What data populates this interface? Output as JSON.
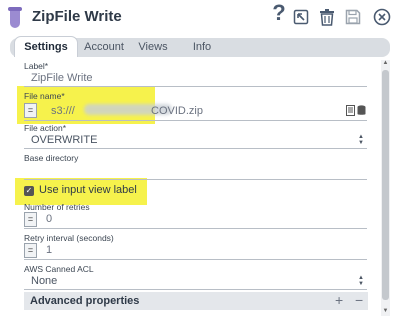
{
  "header": {
    "title": "ZipFile Write",
    "icons": [
      "help-icon",
      "export-icon",
      "delete-icon",
      "save-icon",
      "close-icon"
    ]
  },
  "tabs": [
    {
      "label": "Settings",
      "active": true
    },
    {
      "label": "Account",
      "active": false
    },
    {
      "label": "Views",
      "active": false
    },
    {
      "label": "Info",
      "active": false
    }
  ],
  "form": {
    "label": {
      "label": "Label*",
      "value": "ZipFile Write"
    },
    "file_name": {
      "label": "File name*",
      "eq": "=",
      "prefix": "s3:///",
      "suffix": "COVID.zip"
    },
    "file_action": {
      "label": "File action*",
      "value": "OVERWRITE"
    },
    "base_directory": {
      "label": "Base directory",
      "value": ""
    },
    "use_input_view_label": {
      "label": "Use input view label",
      "checked": true
    },
    "number_of_retries": {
      "label": "Number of retries",
      "eq": "=",
      "value": "0"
    },
    "retry_interval": {
      "label": "Retry interval (seconds)",
      "eq": "=",
      "value": "1"
    },
    "aws_canned_acl": {
      "label": "AWS Canned ACL",
      "value": "None"
    }
  },
  "advanced": {
    "label": "Advanced properties",
    "add": "+",
    "remove": "−"
  },
  "colors": {
    "highlight": "#f6f24c",
    "title": "#2f3a48",
    "tab_bar": "#d9dde2"
  }
}
